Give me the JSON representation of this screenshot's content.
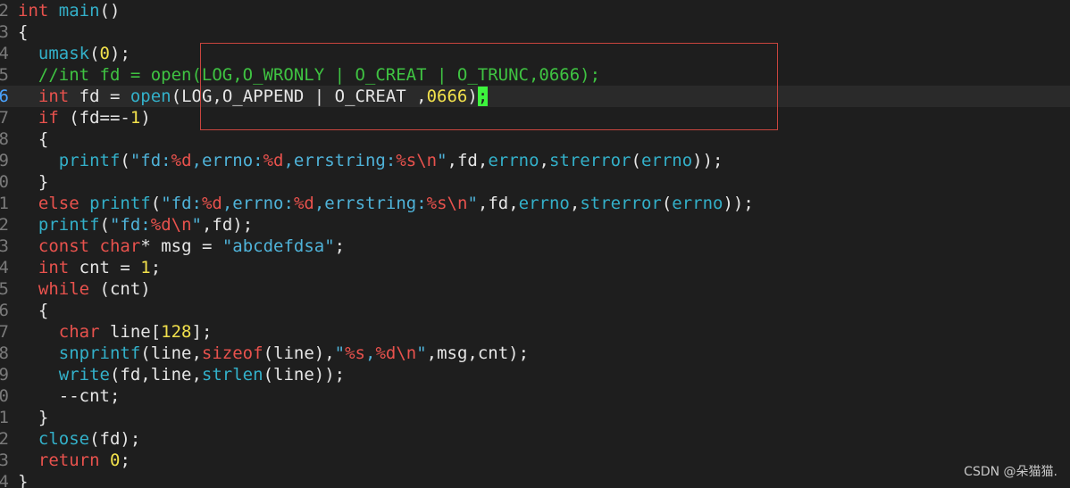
{
  "editor": {
    "current_line_number": "6",
    "cursor_char": ";",
    "watermark": "CSDN @朵猫猫.",
    "colors": {
      "keyword": "#e8524d",
      "function": "#33b0c9",
      "number": "#f2e14c",
      "string": "#4fb3d9",
      "comment": "#3fc342",
      "highlight_box": "#c9453e",
      "cursor": "#3df53d"
    },
    "lines": [
      {
        "num": "2",
        "tokens": [
          {
            "t": "int",
            "c": "kw"
          },
          {
            "t": " ",
            "c": "pl"
          },
          {
            "t": "main",
            "c": "fn"
          },
          {
            "t": "()",
            "c": "pl"
          }
        ]
      },
      {
        "num": "3",
        "tokens": [
          {
            "t": "{",
            "c": "pl"
          }
        ]
      },
      {
        "num": "4",
        "tokens": [
          {
            "t": "  ",
            "c": "pl"
          },
          {
            "t": "umask",
            "c": "fn"
          },
          {
            "t": "(",
            "c": "pl"
          },
          {
            "t": "0",
            "c": "num"
          },
          {
            "t": ");",
            "c": "pl"
          }
        ]
      },
      {
        "num": "5",
        "tokens": [
          {
            "t": "  //int fd = open(LOG,O_WRONLY | O_CREAT | O_TRUNC,0666);",
            "c": "cm"
          }
        ]
      },
      {
        "num": "6",
        "current": true,
        "tokens": [
          {
            "t": "  ",
            "c": "pl"
          },
          {
            "t": "int",
            "c": "kw"
          },
          {
            "t": " fd = ",
            "c": "pl"
          },
          {
            "t": "open",
            "c": "fn"
          },
          {
            "t": "(LOG,O_APPEND | O_CREAT ,",
            "c": "pl"
          },
          {
            "t": "0666",
            "c": "num"
          },
          {
            "t": ")",
            "c": "pl"
          }
        ],
        "cursor": true
      },
      {
        "num": "7",
        "tokens": [
          {
            "t": "  ",
            "c": "pl"
          },
          {
            "t": "if",
            "c": "kw"
          },
          {
            "t": " (fd==-",
            "c": "pl"
          },
          {
            "t": "1",
            "c": "num"
          },
          {
            "t": ")",
            "c": "pl"
          }
        ]
      },
      {
        "num": "8",
        "tokens": [
          {
            "t": "  {",
            "c": "pl"
          }
        ]
      },
      {
        "num": "9",
        "tokens": [
          {
            "t": "    ",
            "c": "pl"
          },
          {
            "t": "printf",
            "c": "fn"
          },
          {
            "t": "(",
            "c": "pl"
          },
          {
            "t": "\"fd:",
            "c": "str"
          },
          {
            "t": "%d",
            "c": "fmt"
          },
          {
            "t": ",errno:",
            "c": "str"
          },
          {
            "t": "%d",
            "c": "fmt"
          },
          {
            "t": ",errstring:",
            "c": "str"
          },
          {
            "t": "%s\\n",
            "c": "fmt"
          },
          {
            "t": "\"",
            "c": "str"
          },
          {
            "t": ",fd,",
            "c": "pl"
          },
          {
            "t": "errno",
            "c": "fn"
          },
          {
            "t": ",",
            "c": "pl"
          },
          {
            "t": "strerror",
            "c": "fn"
          },
          {
            "t": "(",
            "c": "pl"
          },
          {
            "t": "errno",
            "c": "fn"
          },
          {
            "t": "));",
            "c": "pl"
          }
        ]
      },
      {
        "num": "0",
        "tokens": [
          {
            "t": "  }",
            "c": "pl"
          }
        ]
      },
      {
        "num": "1",
        "tokens": [
          {
            "t": "  ",
            "c": "pl"
          },
          {
            "t": "else",
            "c": "kw"
          },
          {
            "t": " ",
            "c": "pl"
          },
          {
            "t": "printf",
            "c": "fn"
          },
          {
            "t": "(",
            "c": "pl"
          },
          {
            "t": "\"fd:",
            "c": "str"
          },
          {
            "t": "%d",
            "c": "fmt"
          },
          {
            "t": ",errno:",
            "c": "str"
          },
          {
            "t": "%d",
            "c": "fmt"
          },
          {
            "t": ",errstring:",
            "c": "str"
          },
          {
            "t": "%s\\n",
            "c": "fmt"
          },
          {
            "t": "\"",
            "c": "str"
          },
          {
            "t": ",fd,",
            "c": "pl"
          },
          {
            "t": "errno",
            "c": "fn"
          },
          {
            "t": ",",
            "c": "pl"
          },
          {
            "t": "strerror",
            "c": "fn"
          },
          {
            "t": "(",
            "c": "pl"
          },
          {
            "t": "errno",
            "c": "fn"
          },
          {
            "t": "));",
            "c": "pl"
          }
        ]
      },
      {
        "num": "2",
        "tokens": [
          {
            "t": "  ",
            "c": "pl"
          },
          {
            "t": "printf",
            "c": "fn"
          },
          {
            "t": "(",
            "c": "pl"
          },
          {
            "t": "\"fd:",
            "c": "str"
          },
          {
            "t": "%d\\n",
            "c": "fmt"
          },
          {
            "t": "\"",
            "c": "str"
          },
          {
            "t": ",fd);",
            "c": "pl"
          }
        ]
      },
      {
        "num": "3",
        "tokens": [
          {
            "t": "  ",
            "c": "pl"
          },
          {
            "t": "const",
            "c": "kw"
          },
          {
            "t": " ",
            "c": "pl"
          },
          {
            "t": "char",
            "c": "kw"
          },
          {
            "t": "* msg = ",
            "c": "pl"
          },
          {
            "t": "\"abcdefdsa\"",
            "c": "str"
          },
          {
            "t": ";",
            "c": "pl"
          }
        ]
      },
      {
        "num": "4",
        "tokens": [
          {
            "t": "  ",
            "c": "pl"
          },
          {
            "t": "int",
            "c": "kw"
          },
          {
            "t": " cnt = ",
            "c": "pl"
          },
          {
            "t": "1",
            "c": "num"
          },
          {
            "t": ";",
            "c": "pl"
          }
        ]
      },
      {
        "num": "5",
        "tokens": [
          {
            "t": "  ",
            "c": "pl"
          },
          {
            "t": "while",
            "c": "kw"
          },
          {
            "t": " (cnt)",
            "c": "pl"
          }
        ]
      },
      {
        "num": "6",
        "tokens": [
          {
            "t": "  {",
            "c": "pl"
          }
        ]
      },
      {
        "num": "7",
        "tokens": [
          {
            "t": "    ",
            "c": "pl"
          },
          {
            "t": "char",
            "c": "kw"
          },
          {
            "t": " line[",
            "c": "pl"
          },
          {
            "t": "128",
            "c": "num"
          },
          {
            "t": "];",
            "c": "pl"
          }
        ]
      },
      {
        "num": "8",
        "tokens": [
          {
            "t": "    ",
            "c": "pl"
          },
          {
            "t": "snprintf",
            "c": "fn"
          },
          {
            "t": "(line,",
            "c": "pl"
          },
          {
            "t": "sizeof",
            "c": "kw"
          },
          {
            "t": "(line),",
            "c": "pl"
          },
          {
            "t": "\"",
            "c": "str"
          },
          {
            "t": "%s",
            "c": "fmt"
          },
          {
            "t": ",",
            "c": "str"
          },
          {
            "t": "%d\\n",
            "c": "fmt"
          },
          {
            "t": "\"",
            "c": "str"
          },
          {
            "t": ",msg,cnt);",
            "c": "pl"
          }
        ]
      },
      {
        "num": "9",
        "tokens": [
          {
            "t": "    ",
            "c": "pl"
          },
          {
            "t": "write",
            "c": "fn"
          },
          {
            "t": "(fd,line,",
            "c": "pl"
          },
          {
            "t": "strlen",
            "c": "fn"
          },
          {
            "t": "(line));",
            "c": "pl"
          }
        ]
      },
      {
        "num": "0",
        "tokens": [
          {
            "t": "    --cnt;",
            "c": "pl"
          }
        ]
      },
      {
        "num": "1",
        "tokens": [
          {
            "t": "  }",
            "c": "pl"
          }
        ]
      },
      {
        "num": "2",
        "tokens": [
          {
            "t": "  ",
            "c": "pl"
          },
          {
            "t": "close",
            "c": "fn"
          },
          {
            "t": "(fd);",
            "c": "pl"
          }
        ]
      },
      {
        "num": "3",
        "tokens": [
          {
            "t": "  ",
            "c": "pl"
          },
          {
            "t": "return",
            "c": "kw"
          },
          {
            "t": " ",
            "c": "pl"
          },
          {
            "t": "0",
            "c": "num"
          },
          {
            "t": ";",
            "c": "pl"
          }
        ]
      },
      {
        "num": "4",
        "tokens": [
          {
            "t": "}",
            "c": "pl"
          }
        ]
      }
    ]
  }
}
